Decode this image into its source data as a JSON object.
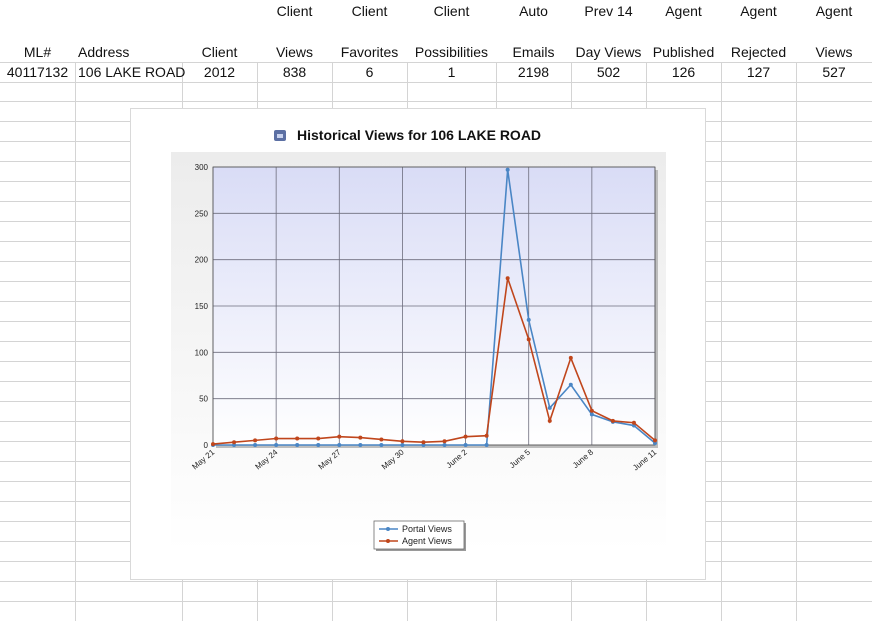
{
  "spreadsheet": {
    "columns": [
      {
        "line1": "",
        "line2": "ML#"
      },
      {
        "line1": "",
        "line2": "Address"
      },
      {
        "line1": "",
        "line2": "Client"
      },
      {
        "line1": "Client",
        "line2": "Views"
      },
      {
        "line1": "Client",
        "line2": "Favorites"
      },
      {
        "line1": "Client",
        "line2": "Possibilities"
      },
      {
        "line1": "Auto",
        "line2": "Emails"
      },
      {
        "line1": "Prev 14",
        "line2": "Day Views"
      },
      {
        "line1": "Agent",
        "line2": "Published"
      },
      {
        "line1": "Agent",
        "line2": "Rejected"
      },
      {
        "line1": "Agent",
        "line2": "Views"
      }
    ],
    "row": [
      "40117132",
      "106 LAKE ROAD",
      "2012",
      "838",
      "6",
      "1",
      "2198",
      "502",
      "126",
      "127",
      "527"
    ]
  },
  "chart_data": {
    "type": "line",
    "title": "Historical Views for 106 LAKE ROAD",
    "title_icon": "chart-icon",
    "x": [
      "May 21",
      "May 22",
      "May 23",
      "May 24",
      "May 25",
      "May 26",
      "May 27",
      "May 28",
      "May 29",
      "May 30",
      "May 31",
      "June 1",
      "June 2",
      "June 3",
      "June 4",
      "June 5",
      "June 6",
      "June 7",
      "June 8",
      "June 9",
      "June 10",
      "June 11"
    ],
    "x_ticks": [
      "May 21",
      "May 24",
      "May 27",
      "May 30",
      "June 2",
      "June 5",
      "June 8",
      "June 11"
    ],
    "ylim": [
      0,
      300
    ],
    "y_ticks": [
      0,
      50,
      100,
      150,
      200,
      250,
      300
    ],
    "grid": true,
    "legend_position": "bottom-center",
    "series": [
      {
        "name": "Portal Views",
        "color": "#4a86c5",
        "values": [
          0,
          0,
          0,
          0,
          0,
          0,
          0,
          0,
          0,
          0,
          0,
          0,
          0,
          0,
          297,
          135,
          40,
          65,
          33,
          25,
          21,
          2
        ]
      },
      {
        "name": "Agent Views",
        "color": "#c0461c",
        "values": [
          1,
          3,
          5,
          7,
          7,
          7,
          9,
          8,
          6,
          4,
          3,
          4,
          9,
          10,
          180,
          114,
          26,
          94,
          37,
          26,
          24,
          5
        ]
      }
    ]
  }
}
